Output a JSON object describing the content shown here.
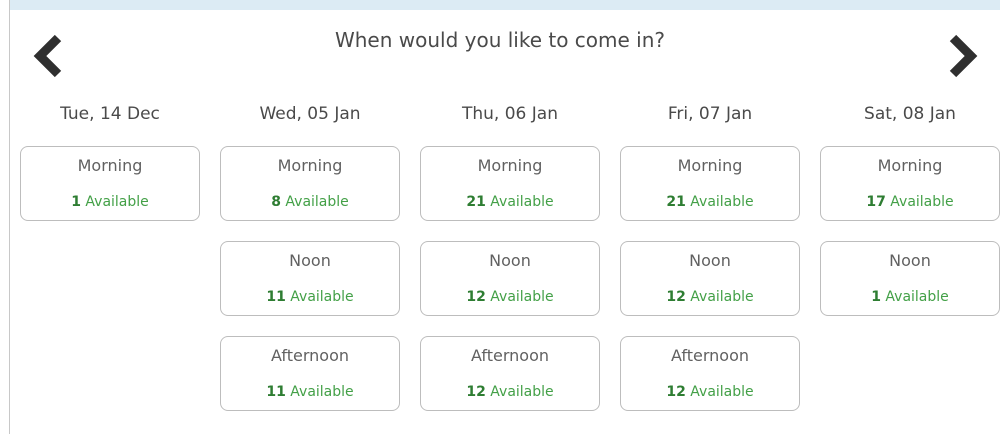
{
  "title": "When would you like to come in?",
  "nav": {
    "prev_icon": "chevron-left-icon",
    "next_icon": "chevron-right-icon",
    "arrow_color": "#2f2f2f"
  },
  "colors": {
    "available": "#2e7d32",
    "top_bar": "#dcebf4"
  },
  "days": [
    {
      "label": "Tue, 14 Dec",
      "slots": [
        {
          "name": "Morning",
          "count": "1",
          "suffix": "Available"
        }
      ]
    },
    {
      "label": "Wed, 05 Jan",
      "slots": [
        {
          "name": "Morning",
          "count": "8",
          "suffix": "Available"
        },
        {
          "name": "Noon",
          "count": "11",
          "suffix": "Available"
        },
        {
          "name": "Afternoon",
          "count": "11",
          "suffix": "Available"
        }
      ]
    },
    {
      "label": "Thu, 06 Jan",
      "slots": [
        {
          "name": "Morning",
          "count": "21",
          "suffix": "Available"
        },
        {
          "name": "Noon",
          "count": "12",
          "suffix": "Available"
        },
        {
          "name": "Afternoon",
          "count": "12",
          "suffix": "Available"
        }
      ]
    },
    {
      "label": "Fri, 07 Jan",
      "slots": [
        {
          "name": "Morning",
          "count": "21",
          "suffix": "Available"
        },
        {
          "name": "Noon",
          "count": "12",
          "suffix": "Available"
        },
        {
          "name": "Afternoon",
          "count": "12",
          "suffix": "Available"
        }
      ]
    },
    {
      "label": "Sat, 08 Jan",
      "slots": [
        {
          "name": "Morning",
          "count": "17",
          "suffix": "Available"
        },
        {
          "name": "Noon",
          "count": "1",
          "suffix": "Available"
        }
      ]
    }
  ]
}
